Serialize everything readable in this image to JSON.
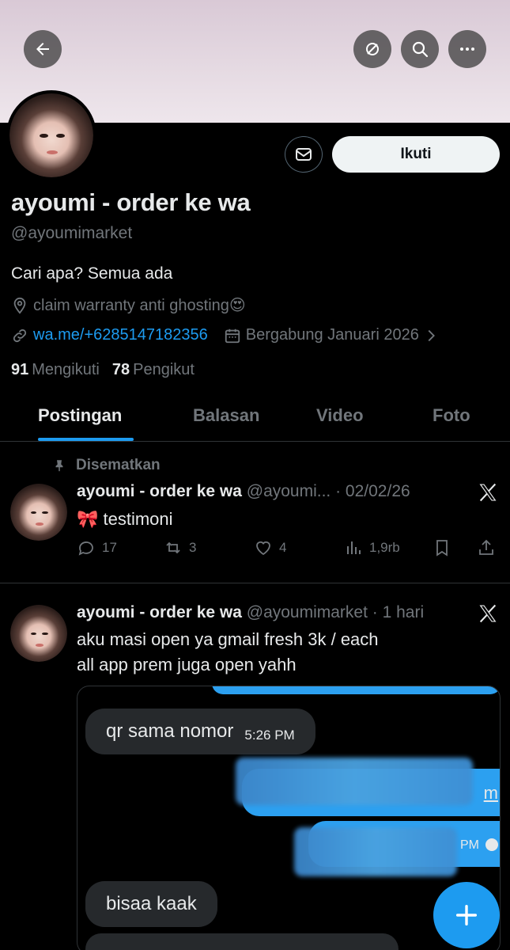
{
  "header": {
    "back_icon": "arrow-left-icon",
    "grok_icon": "grok-icon",
    "search_icon": "search-icon",
    "more_icon": "more-icon"
  },
  "profile": {
    "name": "ayoumi - order ke wa",
    "handle": "@ayoumimarket",
    "bio": "Cari apa? Semua ada",
    "location": "claim warranty anti ghosting😍",
    "website": "wa.me/+6285147182356",
    "joined": "Bergabung Januari 2026",
    "following_count": "91",
    "following_label": "Mengikuti",
    "followers_count": "78",
    "followers_label": "Pengikut",
    "follow_button": "Ikuti"
  },
  "tabs": [
    {
      "label": "Postingan",
      "active": true
    },
    {
      "label": "Balasan",
      "active": false
    },
    {
      "label": "Video",
      "active": false
    },
    {
      "label": "Foto",
      "active": false
    }
  ],
  "posts": [
    {
      "pinned_label": "Disematkan",
      "author": "ayoumi - order ke wa",
      "handle_time": "@ayoumi... · 02/02/26",
      "text": "🎀 testimoni",
      "replies": "17",
      "reposts": "3",
      "likes": "4",
      "views": "1,9rb"
    },
    {
      "author": "ayoumi - order ke wa",
      "handle_time": "@ayoumimarket · 1 hari",
      "text_line1": "aku masi open ya gmail fresh 3k / each",
      "text_line2": "all app prem juga open yahh",
      "media": {
        "msg1": "qr sama nomor",
        "msg1_time": "5:26 PM",
        "out1_tail": "m",
        "out2_tail": "PM",
        "msg2": "bisaa kaak"
      }
    }
  ],
  "colors": {
    "accent": "#1d9bf0",
    "background": "#000000",
    "text_primary": "#e7e9ea",
    "text_secondary": "#71767b"
  }
}
